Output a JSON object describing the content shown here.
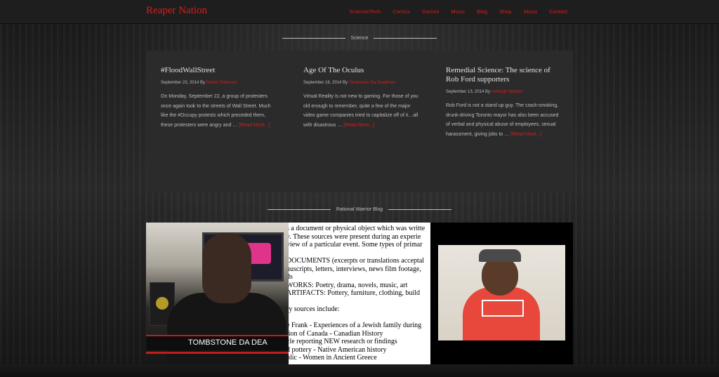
{
  "site": {
    "logo": "Reaper Nation",
    "nav": [
      "Science/Tech",
      "Comics",
      "Games",
      "Music",
      "Blog",
      "Shop",
      "About",
      "Contact"
    ],
    "accent_color": "#d81c1c"
  },
  "science": {
    "heading": "Science",
    "posts": [
      {
        "title": "#FloodWallStreet",
        "date": "September 23, 2014 By",
        "author": "Robert Peterson",
        "excerpt": "On Monday, September 22, a group of protesters once again took to the streets of Wall Street. Much like the #Occupy protests which preceded them, these protesters were angry and …",
        "more": "[Read More...]"
      },
      {
        "title": "Age Of The Oculus",
        "date": "September 16, 2014 By",
        "author": "Tombstone Da Deadman",
        "excerpt": "Virtual Reality is not new to gaming. For those of you old enough to remember, quite a few of the major video game companies tried to capitalize off of it…all with disastrous …",
        "more": "[Read More...]"
      },
      {
        "title": "Remedial Science: The science of Rob Ford supporters",
        "date": "September 13, 2014 By",
        "author": "Ashleigh Mattern",
        "excerpt": "Rob Ford is not a stand up guy. The crack-smoking, drunk-driving Toronto mayor has also been accused of verbal and physical abuse of employees, sexual harassment, giving jobs to …",
        "more": "[Read More...]"
      }
    ]
  },
  "blog": {
    "heading": "Rational Warrior Blog",
    "video1_caption": "TOMBSTONE DA DEA",
    "doc_text": "s a document or physical object which was writte\ny. These sources were present during an experie\nview of a particular event. Some types of primar\n\nDOCUMENTS (excerpts or translations acceptal\nnuscripts, letters, interviews, news film footage,\nds\nWORKS: Poetry, drama, novels, music, art\nARTIFACTS: Pottery, furniture, clothing, build\n\nry sources include:\n\ne Frank - Experiences of a Jewish family during\ntion of Canada - Canadian History\ncle reporting NEW research or findings\nd pottery - Native American history\nblic - Women in Ancient Greece"
  }
}
